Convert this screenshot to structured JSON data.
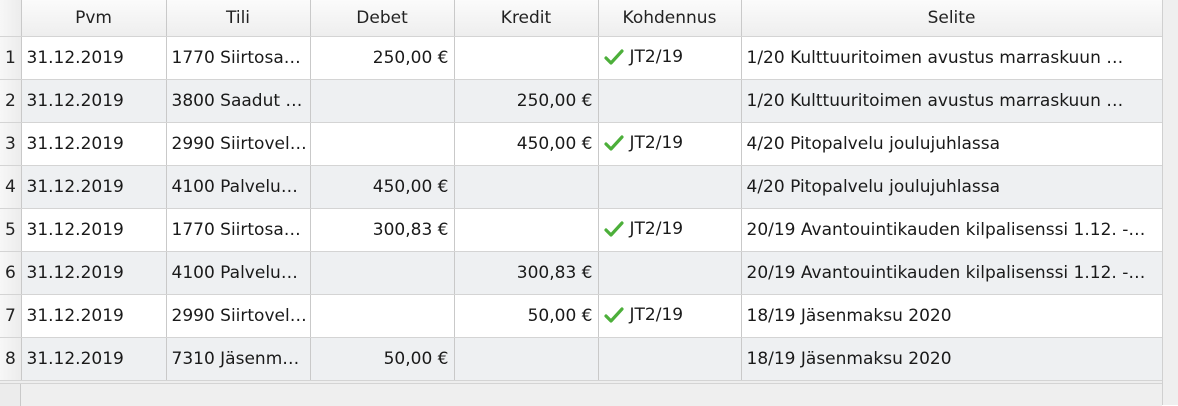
{
  "columns": [
    "",
    "Pvm",
    "Tili",
    "Debet",
    "Kredit",
    "Kohdennus",
    "Selite"
  ],
  "rows": [
    {
      "n": "1",
      "pvm": "31.12.2019",
      "tili": "1770 Siirtosa…",
      "debet": "250,00 €",
      "kredit": "",
      "kohdennus": "JT2/19",
      "check": true,
      "selite": "1/20 Kulttuuritoimen avustus marraskuun …"
    },
    {
      "n": "2",
      "pvm": "31.12.2019",
      "tili": "3800 Saadut …",
      "debet": "",
      "kredit": "250,00 €",
      "kohdennus": "",
      "check": false,
      "selite": "1/20 Kulttuuritoimen avustus marraskuun …"
    },
    {
      "n": "3",
      "pvm": "31.12.2019",
      "tili": "2990 Siirtovel…",
      "debet": "",
      "kredit": "450,00 €",
      "kohdennus": "JT2/19",
      "check": true,
      "selite": "4/20 Pitopalvelu joulujuhlassa"
    },
    {
      "n": "4",
      "pvm": "31.12.2019",
      "tili": "4100 Palvelu…",
      "debet": "450,00 €",
      "kredit": "",
      "kohdennus": "",
      "check": false,
      "selite": "4/20 Pitopalvelu joulujuhlassa"
    },
    {
      "n": "5",
      "pvm": "31.12.2019",
      "tili": "1770 Siirtosa…",
      "debet": "300,83 €",
      "kredit": "",
      "kohdennus": "JT2/19",
      "check": true,
      "selite": "20/19 Avantouintikauden kilpalisenssi 1.12. -…"
    },
    {
      "n": "6",
      "pvm": "31.12.2019",
      "tili": "4100 Palvelu…",
      "debet": "",
      "kredit": "300,83 €",
      "kohdennus": "",
      "check": false,
      "selite": "20/19 Avantouintikauden kilpalisenssi 1.12. -…"
    },
    {
      "n": "7",
      "pvm": "31.12.2019",
      "tili": "2990 Siirtovel…",
      "debet": "",
      "kredit": "50,00 €",
      "kohdennus": "JT2/19",
      "check": true,
      "selite": "18/19 Jäsenmaksu 2020"
    },
    {
      "n": "8",
      "pvm": "31.12.2019",
      "tili": "7310 Jäsenm…",
      "debet": "50,00 €",
      "kredit": "",
      "kohdennus": "",
      "check": false,
      "selite": "18/19 Jäsenmaksu 2020"
    }
  ],
  "icons": {
    "check": "check-icon"
  },
  "colors": {
    "check": "#4caf3a",
    "altRow": "#eef0f2"
  }
}
